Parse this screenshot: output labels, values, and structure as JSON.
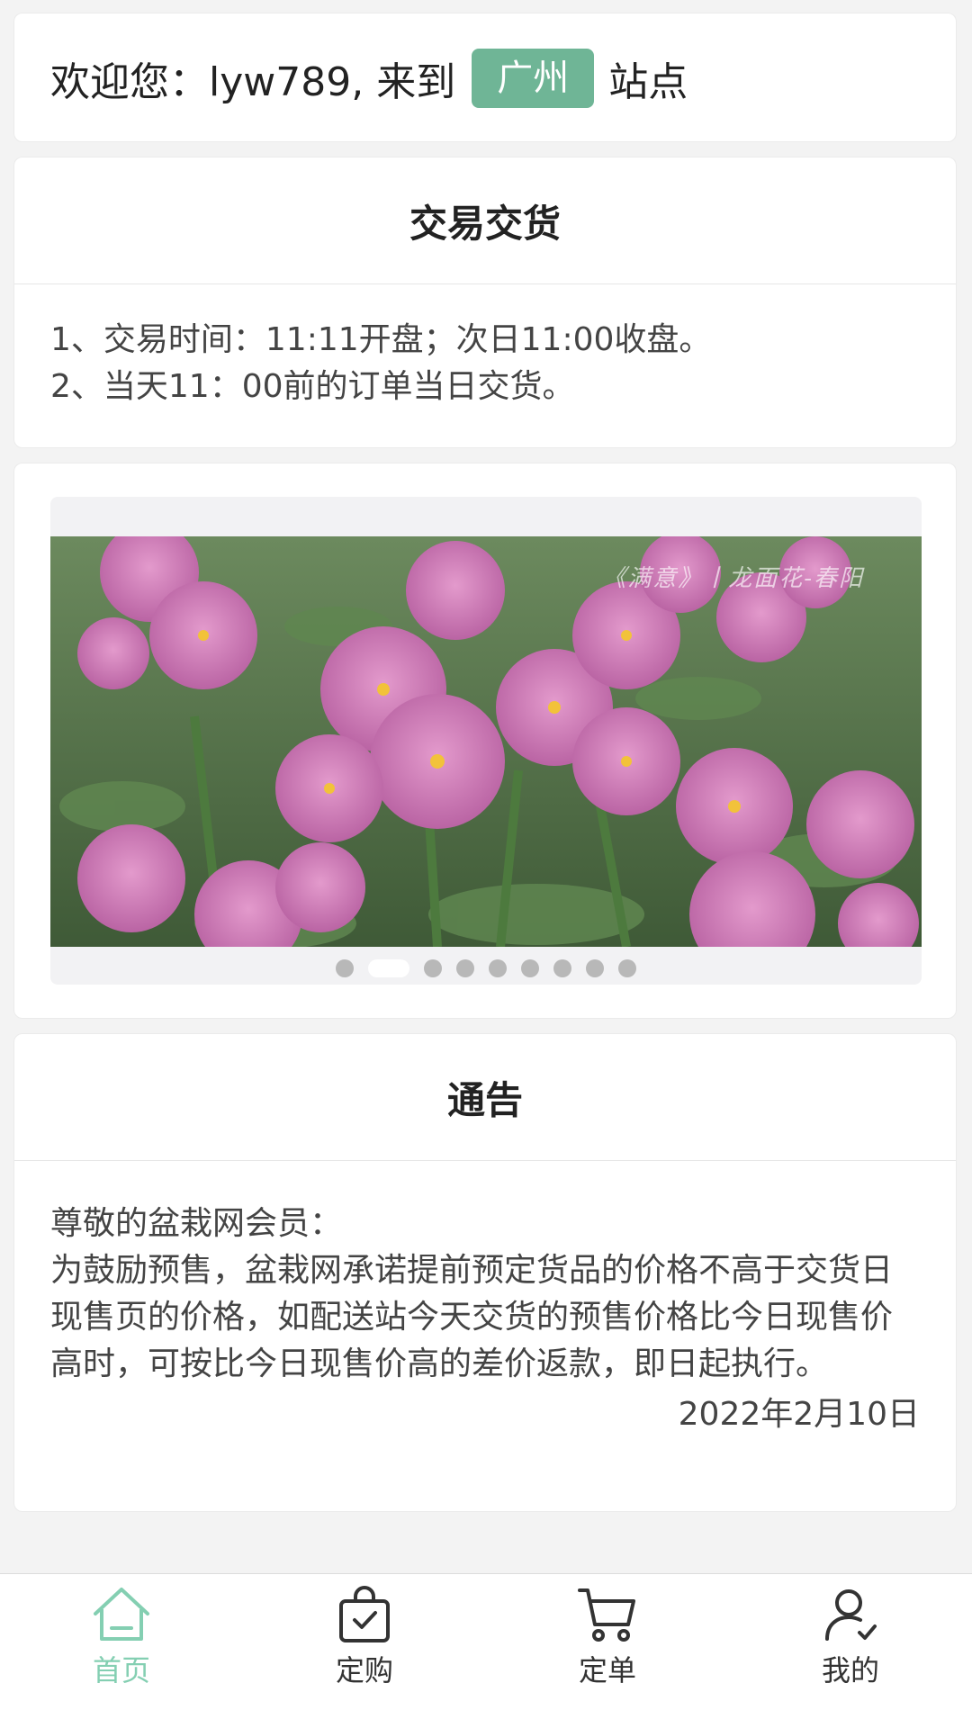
{
  "welcome": {
    "prefix": "欢迎您：lyw789, 来到",
    "city": "广州",
    "suffix": "站点"
  },
  "trade": {
    "title": "交易交货",
    "lines": [
      "1、交易时间：11:11开盘；次日11:00收盘。",
      "2、当天11：00前的订单当日交货。"
    ]
  },
  "banner": {
    "watermark": "《满意》丨龙面花-春阳",
    "slide_count": 9,
    "active_index": 1
  },
  "notice": {
    "title": "通告",
    "greeting": "尊敬的盆栽网会员：",
    "content": "为鼓励预售，盆栽网承诺提前预定货品的价格不高于交货日现售页的价格，如配送站今天交货的预售价格比今日现售价高时，可按比今日现售价高的差价返款，即日起执行。",
    "date": "2022年2月10日"
  },
  "tabbar": {
    "items": [
      {
        "label": "首页",
        "icon": "home-icon",
        "active": true
      },
      {
        "label": "定购",
        "icon": "shopping-bag-icon",
        "active": false
      },
      {
        "label": "定单",
        "icon": "cart-icon",
        "active": false
      },
      {
        "label": "我的",
        "icon": "user-icon",
        "active": false
      }
    ]
  },
  "colors": {
    "accent": "#6fb596",
    "tab_active": "#84cfb2",
    "background": "#f3f3f3"
  }
}
